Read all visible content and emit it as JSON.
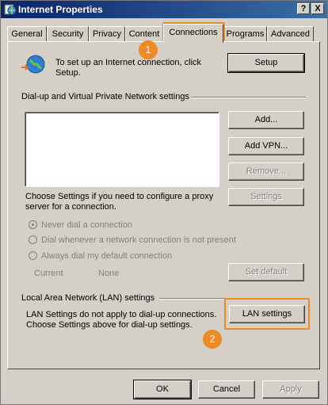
{
  "window": {
    "title": "Internet Properties",
    "help": "?",
    "close": "X"
  },
  "tabs": [
    {
      "label": "General"
    },
    {
      "label": "Security"
    },
    {
      "label": "Privacy"
    },
    {
      "label": "Content"
    },
    {
      "label": "Connections"
    },
    {
      "label": "Programs"
    },
    {
      "label": "Advanced"
    }
  ],
  "active_tab": "Connections",
  "setup": {
    "text_line1": "To set up an Internet connection, click",
    "text_line2": "Setup.",
    "button": "Setup"
  },
  "dialup": {
    "heading": "Dial-up and Virtual Private Network settings",
    "add": "Add...",
    "add_vpn": "Add VPN...",
    "remove": "Remove...",
    "settings": "Settings",
    "hint_line1": "Choose Settings if you need to configure a proxy",
    "hint_line2": "server for a connection.",
    "radio_never": "Never dial a connection",
    "radio_whenever": "Dial whenever a network connection is not present",
    "radio_always": "Always dial my default connection",
    "current_label": "Current",
    "current_value": "None",
    "set_default": "Set default"
  },
  "lan": {
    "heading": "Local Area Network (LAN) settings",
    "text_line1": "LAN Settings do not apply to dial-up connections.",
    "text_line2": "Choose Settings above for dial-up settings.",
    "button": "LAN settings"
  },
  "footer": {
    "ok": "OK",
    "cancel": "Cancel",
    "apply": "Apply"
  },
  "annotations": [
    {
      "label": "1"
    },
    {
      "label": "2"
    }
  ],
  "colors": {
    "accent": "#f08a24",
    "title_bar": "#0a246a",
    "face": "#d4d0c8"
  }
}
